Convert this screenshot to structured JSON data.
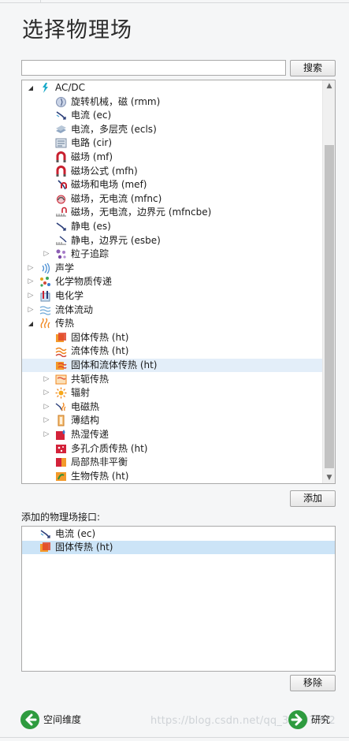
{
  "title": "选择物理场",
  "search": {
    "placeholder": "",
    "button_label": "搜索"
  },
  "tree": [
    {
      "label": "AC/DC",
      "level": 0,
      "caret": "open",
      "icon": "acdc-icon",
      "color": "#19a9c9"
    },
    {
      "label": "旋转机械，磁 (rmm)",
      "level": 1,
      "icon": "rotating-machinery-icon"
    },
    {
      "label": "电流 (ec)",
      "level": 1,
      "icon": "electric-currents-icon"
    },
    {
      "label": "电流，多层壳 (ecls)",
      "level": 1,
      "icon": "layered-shell-icon"
    },
    {
      "label": "电路 (cir)",
      "level": 1,
      "icon": "circuit-icon"
    },
    {
      "label": "磁场 (mf)",
      "level": 1,
      "icon": "magnet-icon"
    },
    {
      "label": "磁场公式 (mfh)",
      "level": 1,
      "icon": "magnet-formulation-icon"
    },
    {
      "label": "磁场和电场 (mef)",
      "level": 1,
      "icon": "magnetic-electric-icon"
    },
    {
      "label": "磁场，无电流 (mfnc)",
      "level": 1,
      "icon": "magnetic-no-current-icon"
    },
    {
      "label": "磁场，无电流，边界元 (mfncbe)",
      "level": 1,
      "icon": "boundary-element-icon"
    },
    {
      "label": "静电 (es)",
      "level": 1,
      "icon": "electrostatics-icon"
    },
    {
      "label": "静电，边界元 (esbe)",
      "level": 1,
      "icon": "electrostatics-be-icon"
    },
    {
      "label": "粒子追踪",
      "level": 1,
      "caret": "closed",
      "icon": "particle-tracing-icon"
    },
    {
      "label": "声学",
      "level": 0,
      "caret": "closed",
      "icon": "acoustics-icon"
    },
    {
      "label": "化学物质传递",
      "level": 0,
      "caret": "closed",
      "icon": "chemical-transport-icon"
    },
    {
      "label": "电化学",
      "level": 0,
      "caret": "closed",
      "icon": "electrochemistry-icon"
    },
    {
      "label": "流体流动",
      "level": 0,
      "caret": "closed",
      "icon": "fluid-flow-icon"
    },
    {
      "label": "传热",
      "level": 0,
      "caret": "open",
      "icon": "heat-transfer-icon"
    },
    {
      "label": "固体传热 (ht)",
      "level": 1,
      "icon": "heat-solids-icon"
    },
    {
      "label": "流体传热 (ht)",
      "level": 1,
      "icon": "heat-fluids-icon"
    },
    {
      "label": "固体和流体传热 (ht)",
      "level": 1,
      "icon": "heat-solids-fluids-icon",
      "selected": true
    },
    {
      "label": "共轭传热",
      "level": 1,
      "caret": "closed",
      "icon": "conjugate-heat-icon"
    },
    {
      "label": "辐射",
      "level": 1,
      "caret": "closed",
      "icon": "radiation-icon"
    },
    {
      "label": "电磁热",
      "level": 1,
      "caret": "closed",
      "icon": "electromagnetic-heating-icon"
    },
    {
      "label": "薄结构",
      "level": 1,
      "caret": "closed",
      "icon": "thin-structures-icon"
    },
    {
      "label": "热湿传递",
      "level": 1,
      "caret": "closed",
      "icon": "heat-moisture-icon"
    },
    {
      "label": "多孔介质传热 (ht)",
      "level": 1,
      "icon": "porous-media-heat-icon"
    },
    {
      "label": "局部热非平衡",
      "level": 1,
      "icon": "local-thermal-nonequilibrium-icon"
    },
    {
      "label": "生物传热 (ht)",
      "level": 1,
      "icon": "bioheat-icon"
    }
  ],
  "add_button_label": "添加",
  "added_section_label": "添加的物理场接口:",
  "added_items": [
    {
      "label": "电流 (ec)",
      "icon": "electric-currents-icon"
    },
    {
      "label": "固体传热 (ht)",
      "icon": "heat-solids-icon",
      "selected": true
    }
  ],
  "remove_button_label": "移除",
  "nav": {
    "back_label": "空间维度",
    "next_label": "研究"
  },
  "watermark": "https://blog.csdn.net/qq_39607092",
  "colors": {
    "accent_green": "#2e9b3f",
    "selection": "#e3eef9",
    "added_selection": "#cce4f7"
  }
}
